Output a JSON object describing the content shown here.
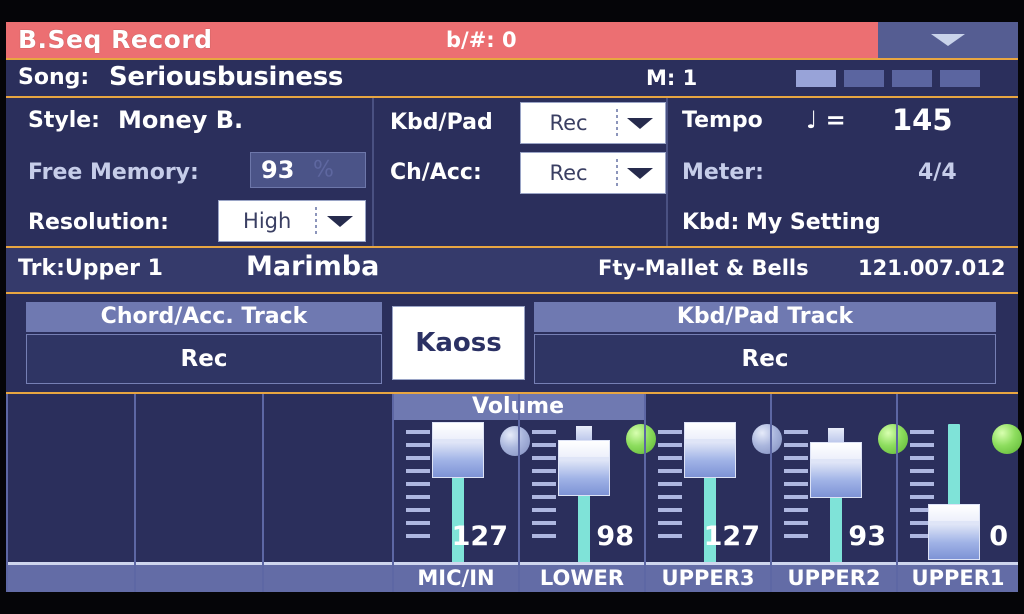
{
  "titlebar": {
    "title": "B.Seq Record",
    "transpose": "b/#: 0",
    "page_menu_icon": "chevron-down-icon"
  },
  "songbar": {
    "song_label": "Song:",
    "song_name": "Seriousbusiness",
    "measure": "M: 1",
    "beats": [
      true,
      false,
      false,
      false
    ]
  },
  "settings": {
    "style_label": "Style:",
    "style_value": "Money B.",
    "free_memory_label": "Free Memory:",
    "free_memory_value": "93",
    "free_memory_unit": "%",
    "resolution_label": "Resolution:",
    "resolution_value": "High",
    "kbd_pad_label": "Kbd/Pad",
    "kbd_pad_value": "Rec",
    "ch_acc_label": "Ch/Acc:",
    "ch_acc_value": "Rec",
    "tempo_label": "Tempo",
    "tempo_note": "♩ =",
    "tempo_value": "145",
    "meter_label": "Meter:",
    "meter_value": "4/4",
    "kbd_label": "Kbd:",
    "kbd_value": "My Setting"
  },
  "track_info": {
    "trk_label": "Trk:Upper 1",
    "sound_name": "Marimba",
    "bank_name": "Fty-Mallet & Bells",
    "program_number": "121.007.012"
  },
  "track_status": {
    "chord_acc_header": "Chord/Acc. Track",
    "chord_acc_value": "Rec",
    "kaoss_button": "Kaoss",
    "kbd_pad_header": "Kbd/Pad Track",
    "kbd_pad_value": "Rec"
  },
  "mixer": {
    "volume_header": "Volume",
    "channels": [
      {
        "name": "",
        "value": null,
        "has_fader": false,
        "led": null
      },
      {
        "name": "",
        "value": null,
        "has_fader": false,
        "led": null
      },
      {
        "name": "",
        "value": null,
        "has_fader": false,
        "led": null
      },
      {
        "name": "MIC/IN",
        "value": "127",
        "has_fader": true,
        "led": "off"
      },
      {
        "name": "LOWER",
        "value": "98",
        "has_fader": true,
        "led": "on"
      },
      {
        "name": "UPPER3",
        "value": "127",
        "has_fader": true,
        "led": "off"
      },
      {
        "name": "UPPER2",
        "value": "93",
        "has_fader": true,
        "led": "on"
      },
      {
        "name": "UPPER1",
        "value": "0",
        "has_fader": true,
        "led": "on"
      }
    ]
  },
  "colors": {
    "title_bar": "#ec6f72",
    "panel_bg": "#2b2f5c",
    "divider": "#e8a641",
    "header_bar": "#6f79b1",
    "fader_track": "#7fe3d8",
    "led_on": "#8ddd5e",
    "led_off": "#aab6dd"
  }
}
